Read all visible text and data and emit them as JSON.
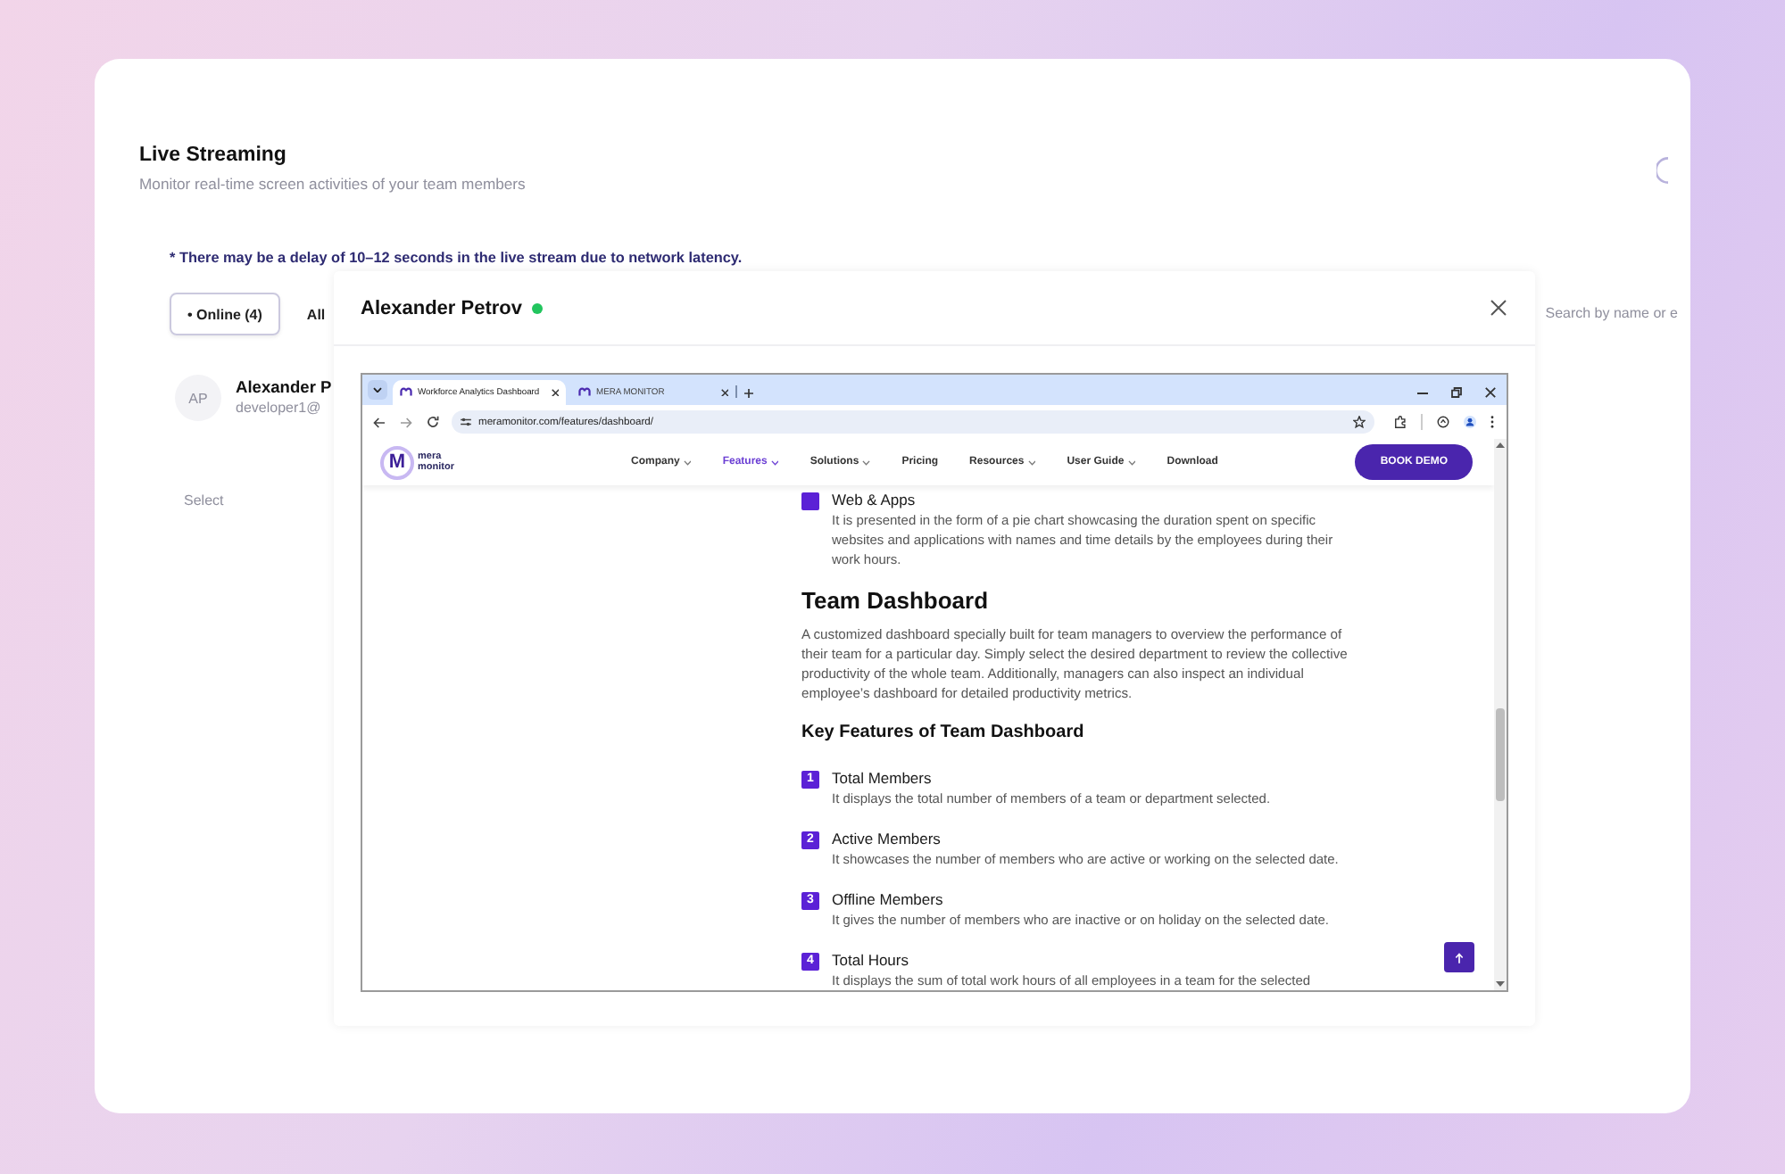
{
  "header": {
    "title": "Live Streaming",
    "subtitle": "Monitor real-time screen activities of your team members"
  },
  "notice": "* There may be a delay of 10–12 seconds in the live stream due to network latency.",
  "filters": [
    {
      "label": "• Online (4)",
      "selected": true
    },
    {
      "label": "All",
      "selected": false
    }
  ],
  "search": {
    "placeholder": "Search by name or e"
  },
  "members": [
    {
      "initials": "AP",
      "name": "Alexander P",
      "email": "developer1@"
    }
  ],
  "table": {
    "columns": [
      "Select"
    ]
  },
  "modal": {
    "title": "Alexander Petrov",
    "online": true,
    "browser": {
      "tabs": [
        {
          "title": "Workforce Analytics Dashboard",
          "selected": true
        },
        {
          "title": "MERA MONITOR",
          "selected": false
        }
      ],
      "url": "meramonitor.com/features/dashboard/"
    },
    "site": {
      "logo": {
        "mark": "M",
        "name": [
          "mera",
          "monitor"
        ]
      },
      "nav": [
        {
          "label": "Company",
          "dropdown": true,
          "selected": false
        },
        {
          "label": "Features",
          "dropdown": true,
          "selected": true
        },
        {
          "label": "Solutions",
          "dropdown": true,
          "selected": false
        },
        {
          "label": "Pricing",
          "dropdown": false,
          "selected": false
        },
        {
          "label": "Resources",
          "dropdown": true,
          "selected": false
        },
        {
          "label": "User Guide",
          "dropdown": true,
          "selected": false
        },
        {
          "label": "Download",
          "dropdown": false,
          "selected": false
        }
      ],
      "cta": "BOOK DEMO",
      "content": [
        {
          "kind": "item",
          "title": "Web & Apps",
          "text": "It is presented in the form of a pie chart showcasing the duration spent on specific websites and applications with names and time details by the employees during their work hours."
        },
        {
          "kind": "heading",
          "text": "Team Dashboard"
        },
        {
          "kind": "paragraph",
          "text": "A customized dashboard specially built for team managers to overview the performance of their team for a particular day. Simply select the desired department to review the collective productivity of the whole team. Additionally, managers can also inspect an individual employee’s dashboard for detailed productivity metrics."
        },
        {
          "kind": "subheading",
          "text": "Key Features of Team Dashboard"
        },
        {
          "kind": "item",
          "number": "1",
          "title": "Total Members",
          "text": "It displays the total number of members of a team or department selected."
        },
        {
          "kind": "item",
          "number": "2",
          "title": "Active Members",
          "text": "It showcases the number of members who are active or working on the selected date."
        },
        {
          "kind": "item",
          "number": "3",
          "title": "Offline Members",
          "text": "It gives the number of members who are inactive or on holiday on the selected date."
        },
        {
          "kind": "item",
          "number": "4",
          "title": "Total Hours",
          "text": "It displays the sum of total work hours of all employees in a team for the selected"
        }
      ]
    }
  }
}
